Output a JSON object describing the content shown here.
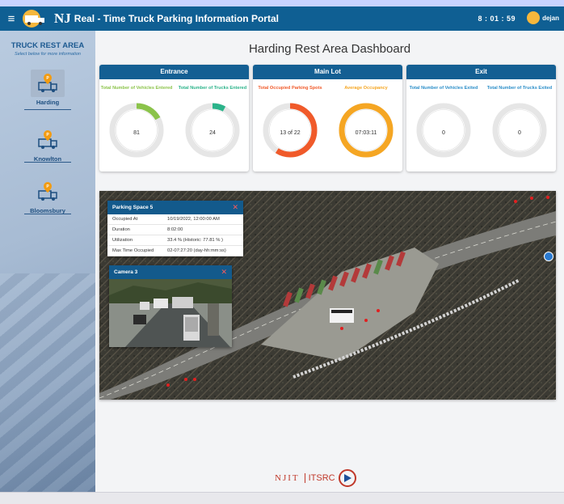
{
  "header": {
    "menu_icon": "hamburger-icon",
    "title_nj": "NJ",
    "title_rest": "Real - Time Truck Parking Information Portal",
    "clock": "8 : 01 : 59",
    "user": "dejan"
  },
  "sidebar": {
    "title": "TRUCK REST AREA",
    "subtitle": "Select below for more information",
    "items": [
      {
        "label": "Harding",
        "icon": "truck-parking-icon"
      },
      {
        "label": "Knowlton",
        "icon": "truck-parking-icon"
      },
      {
        "label": "Bloomsbury",
        "icon": "truck-parking-icon"
      }
    ]
  },
  "dashboard": {
    "title": "Harding Rest Area Dashboard",
    "cards": [
      {
        "header": "Entrance",
        "gauges": [
          {
            "label": "Total Number of Vehicles Entered",
            "value": "81",
            "fraction": 0.17,
            "color": "#8bc34a"
          },
          {
            "label": "Total Number of Trucks Entered",
            "value": "24",
            "fraction": 0.08,
            "color": "#2bb38a"
          }
        ]
      },
      {
        "header": "Main Lot",
        "gauges": [
          {
            "label": "Total Occupied Parking Spots",
            "value": "13 of 22",
            "fraction": 0.59,
            "color": "#f05a2a"
          },
          {
            "label": "Average Occupancy",
            "value": "07:03:11",
            "fraction": 1.0,
            "color": "#f5a623"
          }
        ]
      },
      {
        "header": "Exit",
        "gauges": [
          {
            "label": "Total Number of Vehicles Exited",
            "value": "0",
            "fraction": 0,
            "color": "#2b8ec9"
          },
          {
            "label": "Total Number of Trucks Exited",
            "value": "0",
            "fraction": 0,
            "color": "#2b8ec9"
          }
        ]
      }
    ]
  },
  "parking_popup": {
    "title": "Parking Space 5",
    "rows": [
      {
        "k": "Occupied At",
        "v": "10/19/2022, 12:00:00 AM"
      },
      {
        "k": "Duration",
        "v": "8:02:00"
      },
      {
        "k": "Utilization",
        "v": "33.4 % (Historic: 77.81 % )"
      },
      {
        "k": "Max Time Occupied",
        "v": "02-07:27:20 (day-hh:mm:ss)"
      }
    ]
  },
  "camera_popup": {
    "title": "Camera 3"
  },
  "footer": {
    "njit": "NJIT",
    "itsrc": "ITSRC"
  }
}
